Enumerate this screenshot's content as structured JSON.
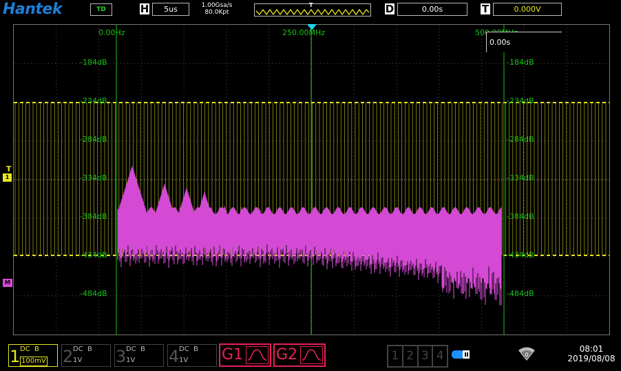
{
  "topbar": {
    "logo": "Hantek",
    "mode_badge": "TD",
    "h_label": "H",
    "timebase": "5us",
    "sample_rate": "1.00Gsa/s",
    "memory_depth": "80.0Kpt",
    "trigger_marker": "T",
    "d_label": "D",
    "delay_value": "0.00s",
    "t_label": "T",
    "trigger_level": "0.000V"
  },
  "screen": {
    "fft_start": "0.00Hz",
    "fft_center": "250.00MHz",
    "fft_end": "500.00MHz",
    "readout": "0.00s",
    "db_labels": [
      "-184dB",
      "-234dB",
      "-284dB",
      "-334dB",
      "-384dB",
      "-434dB",
      "-484dB"
    ],
    "trigger_marker": "T",
    "ch1_marker": "1",
    "math_marker": "M",
    "colors": {
      "ch1": "#e8e820",
      "fft": "#d44ad4",
      "grid": "#19c319",
      "cursor": "#e8e820"
    }
  },
  "channels": [
    {
      "num": "1",
      "coupling": "DC  B",
      "scale": "100mV",
      "active": true
    },
    {
      "num": "2",
      "coupling": "DC  B",
      "scale": "1V",
      "active": false
    },
    {
      "num": "3",
      "coupling": "DC  B",
      "scale": "1V",
      "active": false
    },
    {
      "num": "4",
      "coupling": "DC  B",
      "scale": "1V",
      "active": false
    }
  ],
  "generators": [
    {
      "label": "G1"
    },
    {
      "label": "G2"
    }
  ],
  "channel_selector": [
    "1",
    "2",
    "3",
    "4"
  ],
  "status": {
    "usb_icon": "usb-drive-icon",
    "wifi_icon": "wifi-icon",
    "time": "08:01",
    "date": "2019/08/08"
  }
}
